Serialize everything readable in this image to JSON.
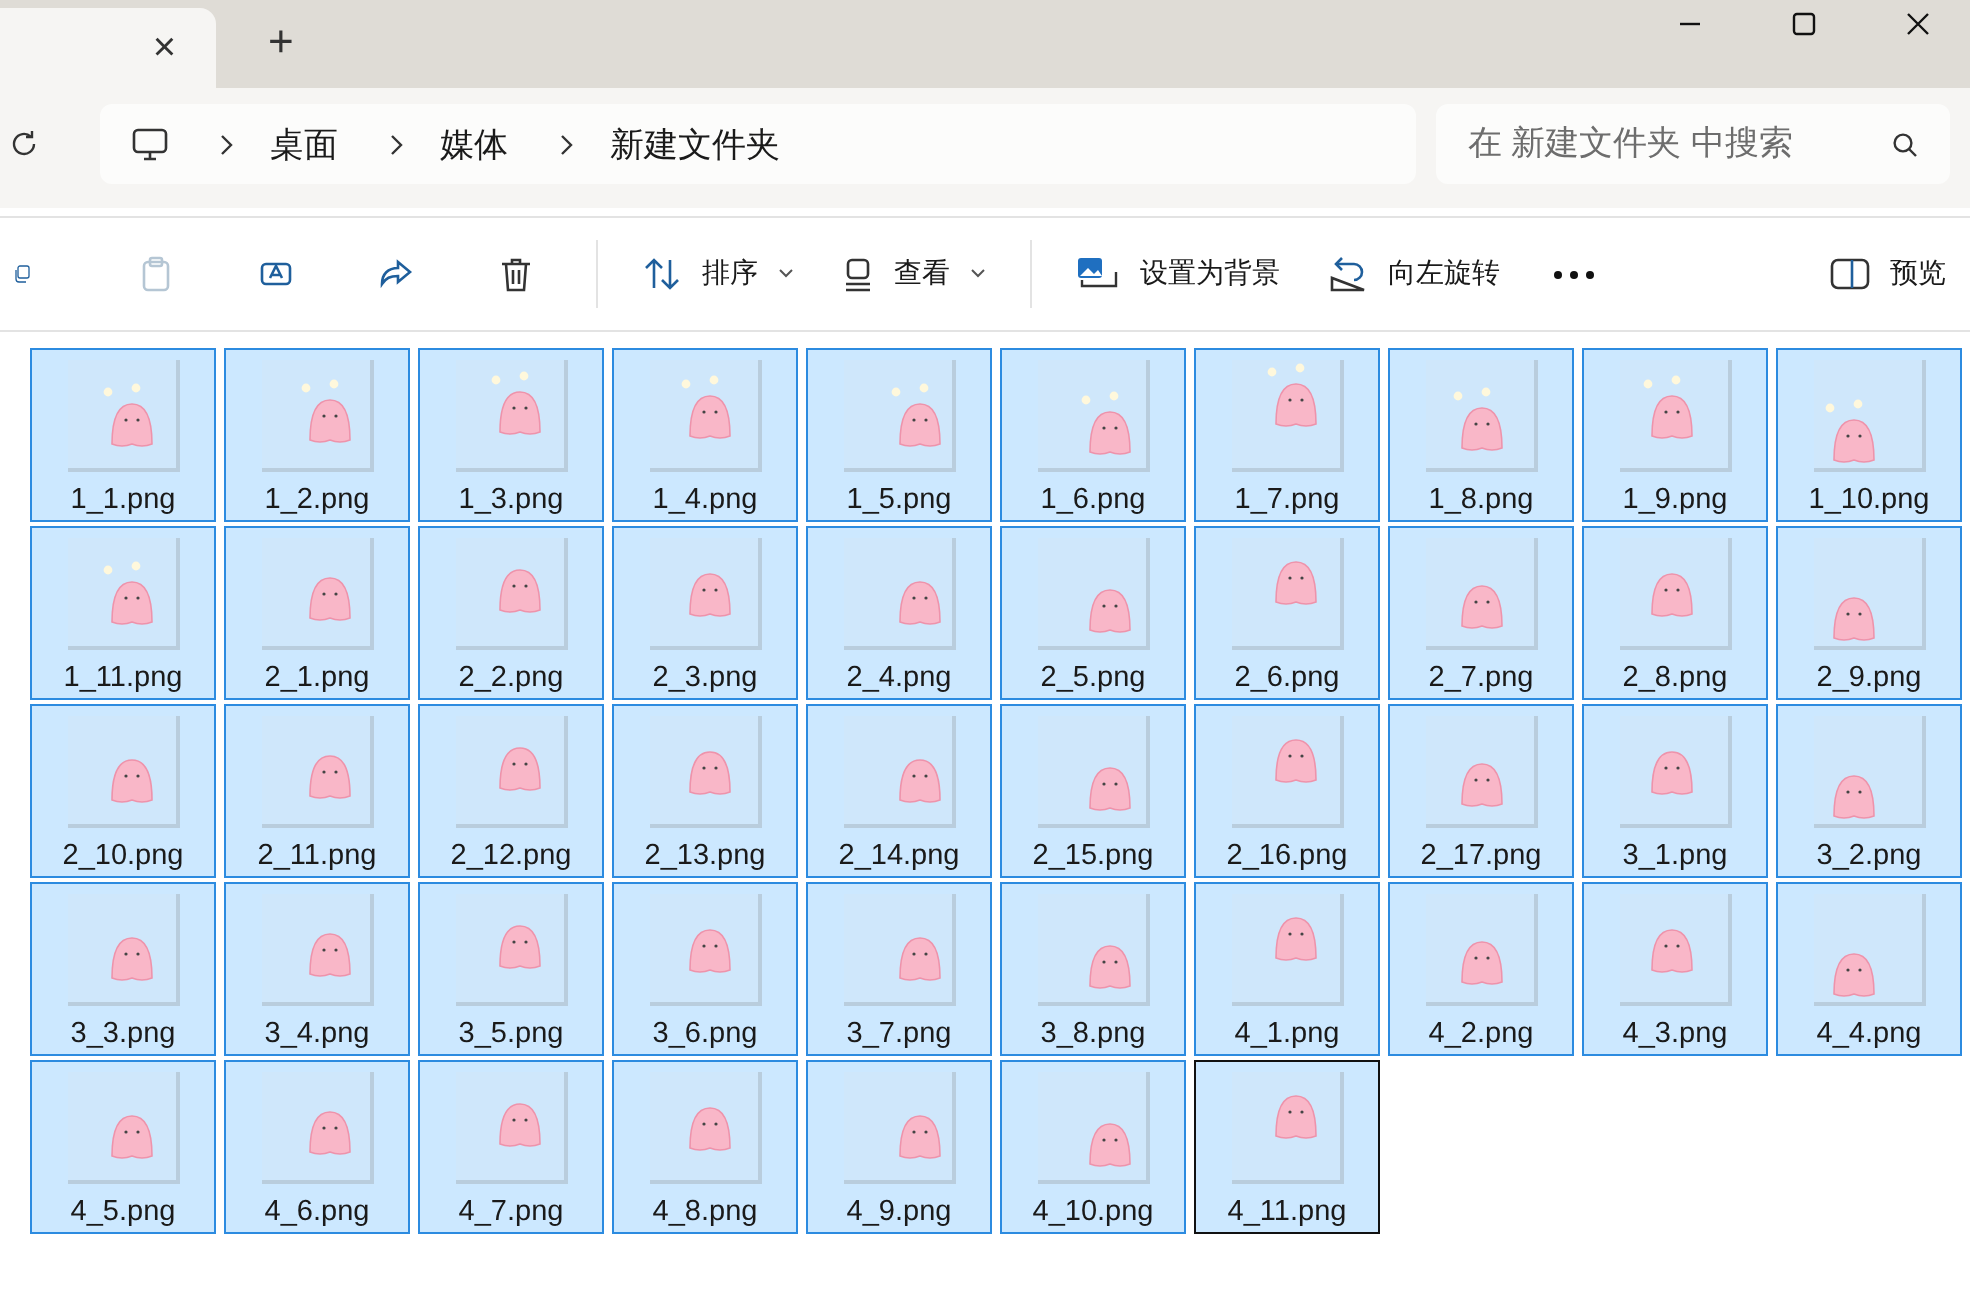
{
  "tab": {
    "close": "×"
  },
  "new_tab": "+",
  "breadcrumbs": [
    "桌面",
    "媒体",
    "新建文件夹"
  ],
  "search": {
    "placeholder": "在 新建文件夹 中搜索"
  },
  "icon_buttons": [
    {
      "disabled": false
    },
    {
      "disabled": true
    },
    {
      "disabled": false
    },
    {
      "disabled": false
    },
    {
      "disabled": false
    }
  ],
  "menus": [
    {
      "label": "排序"
    },
    {
      "label": "查看"
    }
  ],
  "actions": [
    {
      "label": "设置为背景"
    },
    {
      "label": "向左旋转"
    }
  ],
  "preview": {
    "label": "预览"
  },
  "files": [
    {
      "name": "1_1.png",
      "selected": true,
      "focused": false
    },
    {
      "name": "1_2.png",
      "selected": true,
      "focused": false
    },
    {
      "name": "1_3.png",
      "selected": true,
      "focused": false
    },
    {
      "name": "1_4.png",
      "selected": true,
      "focused": false
    },
    {
      "name": "1_5.png",
      "selected": true,
      "focused": false
    },
    {
      "name": "1_6.png",
      "selected": true,
      "focused": false
    },
    {
      "name": "1_7.png",
      "selected": true,
      "focused": false
    },
    {
      "name": "1_8.png",
      "selected": true,
      "focused": false
    },
    {
      "name": "1_9.png",
      "selected": true,
      "focused": false
    },
    {
      "name": "1_10.png",
      "selected": true,
      "focused": false
    },
    {
      "name": "1_11.png",
      "selected": true,
      "focused": false
    },
    {
      "name": "2_1.png",
      "selected": true,
      "focused": false
    },
    {
      "name": "2_2.png",
      "selected": true,
      "focused": false
    },
    {
      "name": "2_3.png",
      "selected": true,
      "focused": false
    },
    {
      "name": "2_4.png",
      "selected": true,
      "focused": false
    },
    {
      "name": "2_5.png",
      "selected": true,
      "focused": false
    },
    {
      "name": "2_6.png",
      "selected": true,
      "focused": false
    },
    {
      "name": "2_7.png",
      "selected": true,
      "focused": false
    },
    {
      "name": "2_8.png",
      "selected": true,
      "focused": false
    },
    {
      "name": "2_9.png",
      "selected": true,
      "focused": false
    },
    {
      "name": "2_10.png",
      "selected": true,
      "focused": false
    },
    {
      "name": "2_11.png",
      "selected": true,
      "focused": false
    },
    {
      "name": "2_12.png",
      "selected": true,
      "focused": false
    },
    {
      "name": "2_13.png",
      "selected": true,
      "focused": false
    },
    {
      "name": "2_14.png",
      "selected": true,
      "focused": false
    },
    {
      "name": "2_15.png",
      "selected": true,
      "focused": false
    },
    {
      "name": "2_16.png",
      "selected": true,
      "focused": false
    },
    {
      "name": "2_17.png",
      "selected": true,
      "focused": false
    },
    {
      "name": "3_1.png",
      "selected": true,
      "focused": false
    },
    {
      "name": "3_2.png",
      "selected": true,
      "focused": false
    },
    {
      "name": "3_3.png",
      "selected": true,
      "focused": false
    },
    {
      "name": "3_4.png",
      "selected": true,
      "focused": false
    },
    {
      "name": "3_5.png",
      "selected": true,
      "focused": false
    },
    {
      "name": "3_6.png",
      "selected": true,
      "focused": false
    },
    {
      "name": "3_7.png",
      "selected": true,
      "focused": false
    },
    {
      "name": "3_8.png",
      "selected": true,
      "focused": false
    },
    {
      "name": "4_1.png",
      "selected": true,
      "focused": false
    },
    {
      "name": "4_2.png",
      "selected": true,
      "focused": false
    },
    {
      "name": "4_3.png",
      "selected": true,
      "focused": false
    },
    {
      "name": "4_4.png",
      "selected": true,
      "focused": false
    },
    {
      "name": "4_5.png",
      "selected": true,
      "focused": false
    },
    {
      "name": "4_6.png",
      "selected": true,
      "focused": false
    },
    {
      "name": "4_7.png",
      "selected": true,
      "focused": false
    },
    {
      "name": "4_8.png",
      "selected": true,
      "focused": false
    },
    {
      "name": "4_9.png",
      "selected": true,
      "focused": false
    },
    {
      "name": "4_10.png",
      "selected": true,
      "focused": false
    },
    {
      "name": "4_11.png",
      "selected": true,
      "focused": true
    }
  ]
}
